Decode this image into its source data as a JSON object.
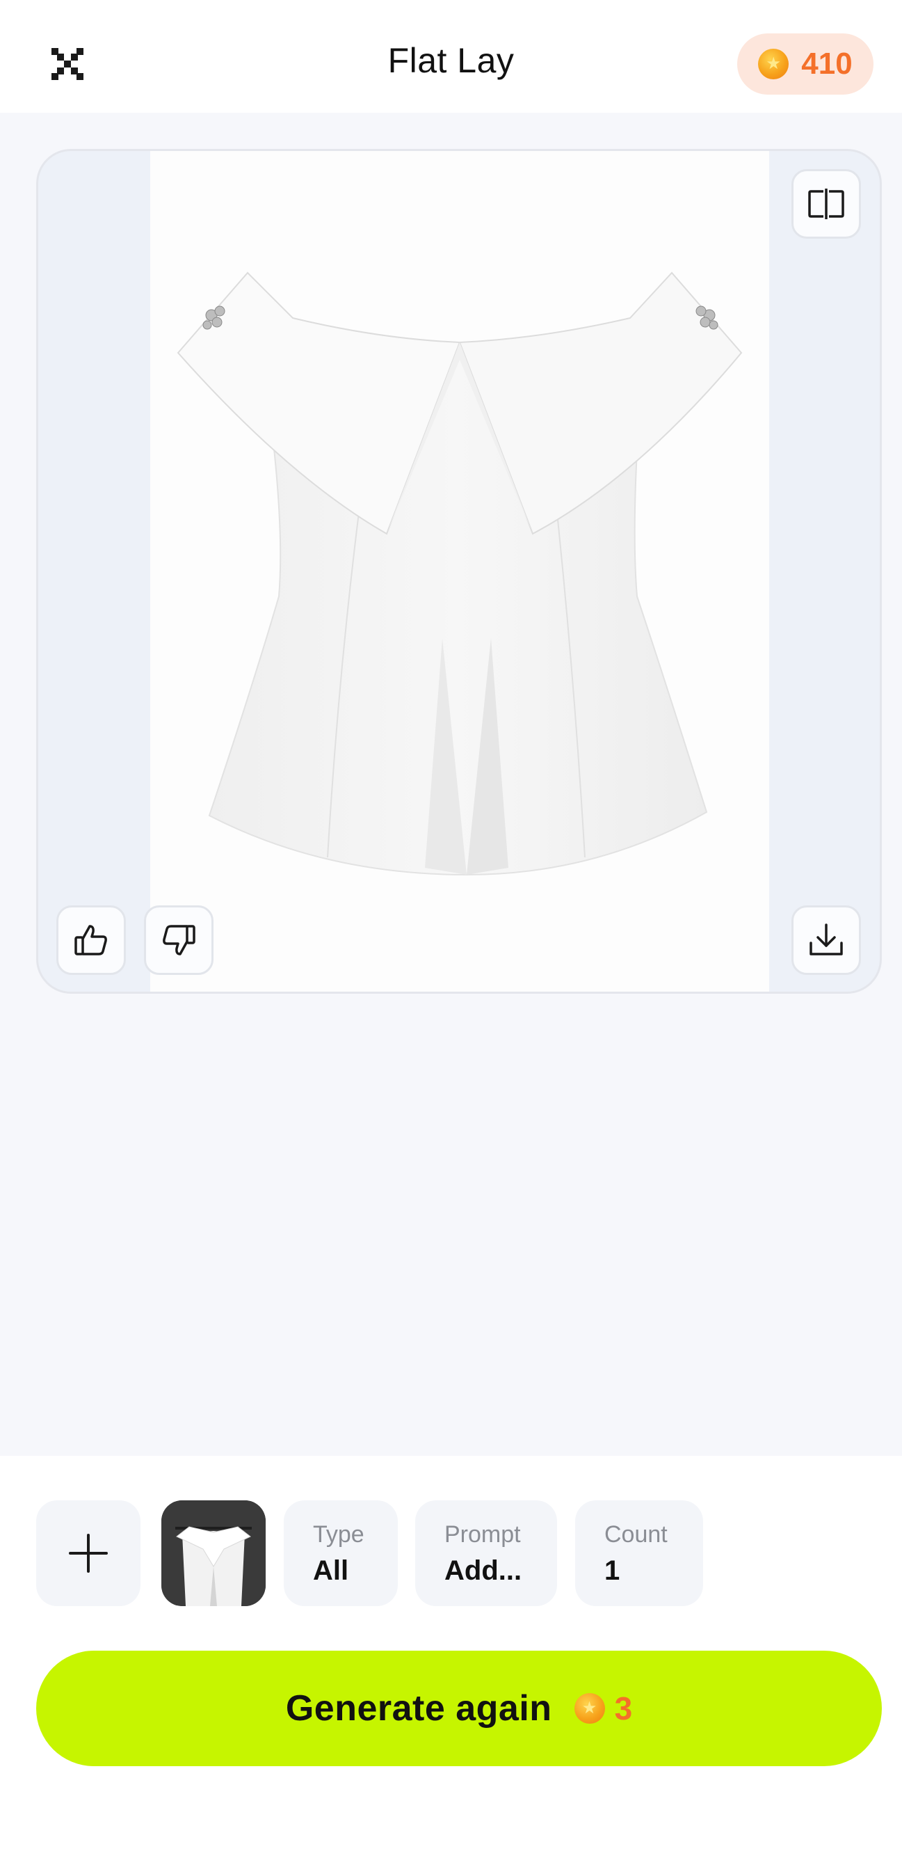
{
  "header": {
    "title": "Flat Lay",
    "coin_balance": "410",
    "close_icon": "close-icon",
    "coin_icon": "coin-icon"
  },
  "result_card": {
    "image_subject": "white off-shoulder top with folded collar",
    "compare_icon": "compare-icon",
    "like_icon": "thumbs-up-icon",
    "dislike_icon": "thumbs-down-icon",
    "download_icon": "download-icon"
  },
  "options": {
    "add_icon": "plus-icon",
    "type": {
      "label": "Type",
      "value": "All"
    },
    "prompt": {
      "label": "Prompt",
      "value": "Add..."
    },
    "count": {
      "label": "Count",
      "value": "1"
    }
  },
  "generate": {
    "label": "Generate again",
    "cost": "3"
  },
  "colors": {
    "accent": "#c6f500",
    "coin_text": "#f4702a",
    "badge_bg": "#fde6dc",
    "page_bg": "#f6f7fb"
  }
}
